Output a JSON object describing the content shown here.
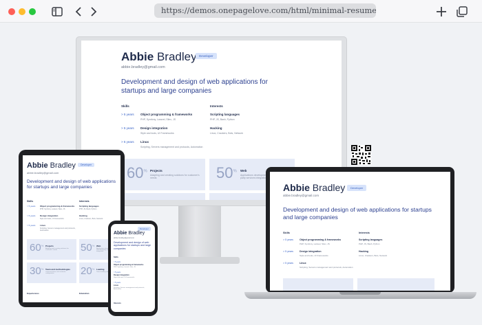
{
  "browser": {
    "url": "https://demos.onepagelove.com/html/minimal-resume/",
    "colors": {
      "close": "#fe5f57",
      "minimize": "#febc2e",
      "maximize": "#28c840"
    }
  },
  "resume": {
    "first_name": "Abbie",
    "last_name": "Bradley",
    "badge": "Developer",
    "email": "abbie.bradley@gmail.com",
    "headline": "Development and design of web applications for startups and large companies",
    "skills_title": "Skills",
    "interests_title": "Interests",
    "skills": [
      {
        "years": "> 5 years",
        "title": "Object programming & frameworks",
        "sub": "PHP, Symfony, Laravel, Silex, JS"
      },
      {
        "years": "> 5 years",
        "title": "Design integration",
        "sub": "Style and tools, UI Frameworks"
      },
      {
        "years": "> 5 years",
        "title": "Linux",
        "sub": "Scripting, Servers management and protocols, Automation"
      }
    ],
    "interests": [
      {
        "title": "Scripting languages",
        "sub": "PHP, JS, Bash, Python"
      },
      {
        "title": "Hacking",
        "sub": "Linux, Crackers, Bots, Network"
      }
    ],
    "stats": [
      {
        "num": "60",
        "unit": "%",
        "label": "Projects",
        "sub": "Adapting and creating solutions for customer's needs"
      },
      {
        "num": "50",
        "unit": "%",
        "label": "Web",
        "sub": "Applications development and third-party services integration"
      },
      {
        "num": "30",
        "unit": "%",
        "label": "Team and methodologies",
        "sub": "Communication, task estimate, configuration"
      },
      {
        "num": "20",
        "unit": "%",
        "label": "Leading",
        "sub": "Team building and leading"
      }
    ],
    "experiences_title": "Experiences",
    "education_title": "Education",
    "interests_short": "Interests"
  }
}
